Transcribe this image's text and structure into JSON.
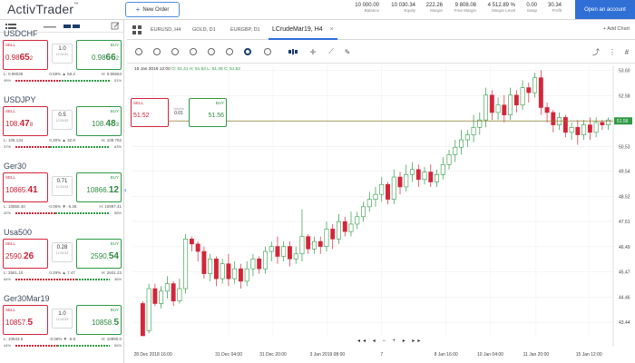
{
  "header": {
    "logo": "ActivTrader",
    "logo_mark": "™",
    "new_order_label": "New Order",
    "open_account_label": "Open an account",
    "account": [
      {
        "value": "10 000.00",
        "label": "Balance"
      },
      {
        "value": "10 030.34",
        "label": "Equity"
      },
      {
        "value": "222.26",
        "label": "Margin"
      },
      {
        "value": "9 808.08",
        "label": "Free Margin"
      },
      {
        "value": "4 512.89 %",
        "label": "Margin Level"
      },
      {
        "value": "0.00",
        "label": "Swap"
      },
      {
        "value": "30.34",
        "label": "Profit"
      }
    ]
  },
  "instruments": [
    {
      "name": "USDCHF",
      "sell_pre": "0.98",
      "sell_big": "65",
      "sell_post": "2",
      "buy_pre": "0.98",
      "buy_big": "66",
      "buy_post": "2",
      "spread": "1.0",
      "time": "12:34:51",
      "low": "L: 0.98038",
      "change": "0.59% ▲ 58.2",
      "high": "H: 0.98663",
      "left_pct": "49%",
      "right_pct": "51%",
      "sell_ratio": 0.49
    },
    {
      "name": "USDJPY",
      "sell_pre": "108.",
      "sell_big": "47",
      "sell_post": "8",
      "buy_pre": "108.",
      "buy_big": "48",
      "buy_post": "3",
      "spread": "0.5",
      "time": "12:34:53",
      "low": "L: 108.134",
      "change": "0.30% ▲ 32.8",
      "high": "H: 108.752",
      "left_pct": "37%",
      "right_pct": "63%",
      "sell_ratio": 0.37
    },
    {
      "name": "Ger30",
      "sell_pre": "10865.",
      "sell_big": "41",
      "sell_post": "",
      "buy_pre": "10866.",
      "buy_big": "12",
      "buy_post": "",
      "spread": "0.71",
      "time": "12:34:54",
      "low": "L: 10855.40",
      "change": "-0.06% ▼ -6.28",
      "high": "H: 10997.41",
      "left_pct": "42%",
      "right_pct": "58%",
      "sell_ratio": 0.42
    },
    {
      "name": "Usa500",
      "sell_pre": "2590.",
      "sell_big": "26",
      "sell_post": "",
      "buy_pre": "2590.",
      "buy_big": "54",
      "buy_post": "",
      "spread": "0.28",
      "time": "12:34:53",
      "low": "L: 2581.10",
      "change": "0.29% ▲ 7.47",
      "high": "H: 2601.23",
      "left_pct": "64%",
      "right_pct": "36%",
      "sell_ratio": 0.64
    },
    {
      "name": "Ger30Mar19",
      "sell_pre": "10857.",
      "sell_big": "5",
      "sell_post": "",
      "buy_pre": "10858.",
      "buy_big": "5",
      "buy_post": "",
      "spread": "1.0",
      "time": "12:34:54",
      "low": "L: 10843.5",
      "change": "-0.06% ▼ -6.5",
      "high": "H: 10990.0",
      "left_pct": "44%",
      "right_pct": "56%",
      "sell_ratio": 0.44
    }
  ],
  "sell_label": "SELL",
  "buy_label": "BUY",
  "tabs": [
    {
      "label": "EURUSD, H4"
    },
    {
      "label": "GOLD, D1"
    },
    {
      "label": "EURGBP, D1"
    },
    {
      "label": "LCrudeMar19, H4",
      "active": true
    }
  ],
  "add_chart_label": "+ Add Chart",
  "chart_info": {
    "prefix": "15 Jan 2019 12:00",
    "ohlc": "O: 51.41 H: 51.64 L: 51.36 C: 51.52"
  },
  "trade_panel": {
    "sell_price": "51.52",
    "buy_price": "51.56",
    "spread": "0.01",
    "spread_label": "Volume"
  },
  "nav_controls": "◂◂ ◂ − + ▸ ▸▸",
  "colors": {
    "up": "#2e9a45",
    "down": "#d3263a",
    "accent": "#2f6fd6",
    "line": "#8a7a2a"
  },
  "chart_data": {
    "type": "candlestick",
    "title": "",
    "ylim": [
      42.9,
      53.8
    ],
    "yticks": [
      "53.60",
      "52.58",
      "51.56",
      "50.53",
      "49.54",
      "48.52",
      "47.51",
      "46.49",
      "45.47",
      "44.46",
      "43.44"
    ],
    "xticks": [
      "28 Dec 2018 16:00",
      "31 Dec 04:00",
      "31 Dec 20:00",
      "3 Jan 2019 08:00",
      "7",
      "8 Jan 16:00",
      "10 Jan 04:00",
      "11 Jan 20:00",
      "15 Jan 12:00"
    ],
    "current_price": "51.56",
    "candles": [
      [
        44.2,
        42.9,
        43.1,
        44.3
      ],
      [
        43.1,
        44.8,
        43.0,
        45.0
      ],
      [
        44.8,
        44.2,
        44.1,
        45.0
      ],
      [
        44.2,
        44.7,
        44.0,
        44.9
      ],
      [
        44.7,
        45.0,
        44.4,
        45.3
      ],
      [
        45.0,
        44.3,
        44.1,
        45.1
      ],
      [
        44.3,
        44.8,
        44.2,
        45.2
      ],
      [
        44.8,
        46.8,
        44.6,
        47.0
      ],
      [
        46.8,
        46.6,
        46.3,
        46.9
      ],
      [
        46.6,
        46.3,
        45.9,
        46.7
      ],
      [
        46.3,
        45.4,
        45.2,
        46.5
      ],
      [
        45.4,
        46.0,
        45.1,
        46.2
      ],
      [
        46.0,
        45.2,
        44.9,
        46.1
      ],
      [
        45.2,
        45.8,
        45.0,
        46.0
      ],
      [
        45.8,
        45.2,
        44.9,
        46.2
      ],
      [
        45.2,
        45.6,
        45.0,
        45.9
      ],
      [
        45.6,
        45.1,
        44.8,
        45.8
      ],
      [
        45.1,
        45.6,
        44.9,
        45.9
      ],
      [
        45.6,
        46.0,
        45.3,
        46.2
      ],
      [
        46.0,
        45.6,
        45.4,
        46.1
      ],
      [
        45.6,
        46.3,
        45.4,
        46.5
      ],
      [
        46.3,
        46.5,
        45.9,
        46.7
      ],
      [
        46.5,
        46.1,
        45.8,
        46.9
      ],
      [
        46.1,
        46.5,
        45.9,
        46.7
      ],
      [
        46.5,
        46.0,
        45.7,
        46.7
      ],
      [
        46.0,
        46.2,
        45.8,
        46.5
      ],
      [
        46.2,
        46.9,
        45.9,
        48.0
      ],
      [
        46.9,
        46.4,
        46.2,
        47.0
      ],
      [
        46.4,
        46.7,
        46.2,
        46.9
      ],
      [
        46.7,
        46.5,
        46.2,
        46.9
      ],
      [
        46.5,
        47.2,
        46.3,
        47.5
      ],
      [
        47.2,
        46.8,
        46.4,
        47.4
      ],
      [
        46.8,
        47.5,
        46.6,
        47.8
      ],
      [
        47.5,
        47.1,
        46.9,
        47.7
      ],
      [
        47.1,
        47.4,
        46.9,
        47.9
      ],
      [
        47.4,
        47.7,
        47.2,
        47.9
      ],
      [
        47.7,
        48.1,
        47.5,
        48.3
      ],
      [
        48.1,
        48.4,
        47.9,
        48.7
      ],
      [
        48.4,
        48.6,
        48.1,
        48.9
      ],
      [
        48.6,
        49.0,
        48.3,
        49.3
      ],
      [
        49.0,
        48.4,
        48.2,
        49.1
      ],
      [
        48.4,
        49.3,
        48.2,
        49.6
      ],
      [
        49.3,
        48.9,
        48.6,
        49.5
      ],
      [
        48.9,
        49.4,
        48.7,
        49.8
      ],
      [
        49.4,
        49.6,
        49.1,
        49.9
      ],
      [
        49.6,
        49.2,
        48.9,
        49.8
      ],
      [
        49.2,
        49.5,
        49.0,
        49.7
      ],
      [
        49.5,
        49.1,
        48.9,
        49.8
      ],
      [
        49.1,
        49.4,
        48.9,
        49.6
      ],
      [
        49.4,
        49.8,
        49.2,
        50.1
      ],
      [
        49.8,
        50.2,
        49.6,
        50.4
      ],
      [
        50.2,
        50.5,
        49.9,
        50.8
      ],
      [
        50.5,
        50.8,
        50.2,
        51.2
      ],
      [
        50.8,
        51.0,
        50.5,
        51.2
      ],
      [
        51.0,
        51.3,
        50.7,
        51.8
      ],
      [
        51.3,
        51.6,
        51.0,
        51.9
      ],
      [
        51.6,
        52.6,
        51.3,
        52.9
      ],
      [
        52.6,
        51.9,
        51.6,
        52.8
      ],
      [
        51.9,
        52.2,
        51.6,
        52.5
      ],
      [
        52.2,
        51.8,
        51.5,
        52.6
      ],
      [
        51.8,
        52.6,
        51.6,
        52.9
      ],
      [
        52.6,
        52.2,
        51.9,
        52.8
      ],
      [
        52.2,
        52.9,
        52.0,
        53.2
      ],
      [
        52.9,
        52.7,
        52.3,
        53.1
      ],
      [
        52.7,
        53.3,
        52.5,
        53.5
      ],
      [
        53.3,
        52.1,
        51.8,
        53.6
      ],
      [
        52.1,
        51.9,
        51.5,
        52.3
      ],
      [
        51.9,
        51.4,
        51.1,
        52.0
      ],
      [
        51.4,
        51.7,
        51.2,
        51.9
      ],
      [
        51.7,
        51.1,
        50.9,
        51.8
      ],
      [
        51.1,
        51.3,
        50.8,
        51.5
      ],
      [
        51.3,
        51.0,
        50.6,
        51.6
      ],
      [
        51.0,
        51.4,
        50.8,
        51.6
      ],
      [
        51.4,
        51.1,
        50.8,
        51.7
      ],
      [
        51.1,
        51.5,
        50.9,
        51.7
      ],
      [
        51.5,
        51.4,
        51.2,
        51.6
      ],
      [
        51.4,
        51.6,
        51.2,
        51.7
      ]
    ]
  }
}
